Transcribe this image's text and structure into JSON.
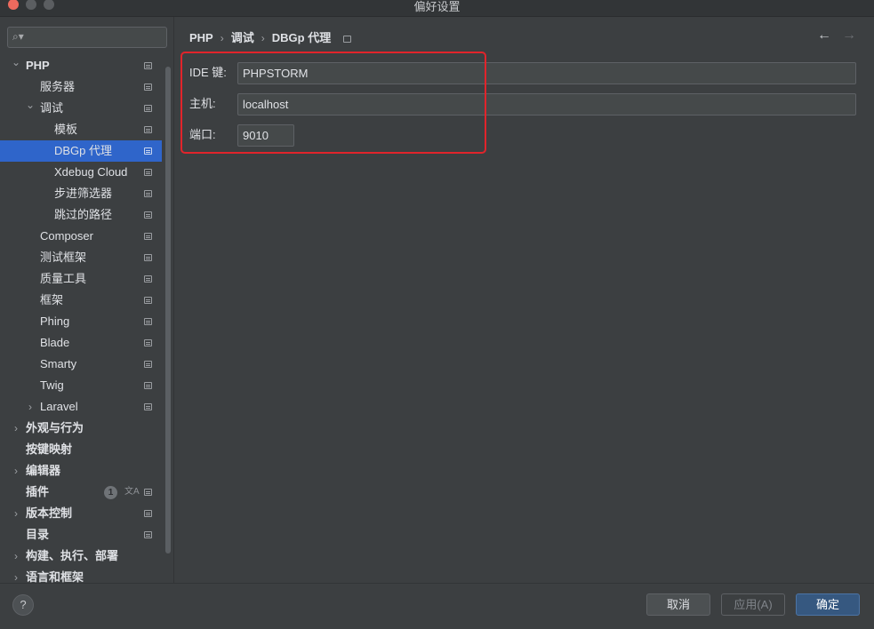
{
  "window": {
    "title": "偏好设置"
  },
  "sidebar": {
    "search": {
      "placeholder": ""
    },
    "items": [
      {
        "label": "PHP",
        "level": 0,
        "expanded": true,
        "bold": true,
        "pin": true
      },
      {
        "label": "服务器",
        "level": 1,
        "pin": true
      },
      {
        "label": "调试",
        "level": 1,
        "expanded": true,
        "pin": true
      },
      {
        "label": "模板",
        "level": 2,
        "pin": true
      },
      {
        "label": "DBGp 代理",
        "level": 2,
        "selected": true,
        "pin": true
      },
      {
        "label": "Xdebug Cloud",
        "level": 2,
        "pin": true
      },
      {
        "label": "步进筛选器",
        "level": 2,
        "pin": true
      },
      {
        "label": "跳过的路径",
        "level": 2,
        "pin": true
      },
      {
        "label": "Composer",
        "level": 1,
        "pin": true
      },
      {
        "label": "测试框架",
        "level": 1,
        "pin": true
      },
      {
        "label": "质量工具",
        "level": 1,
        "pin": true
      },
      {
        "label": "框架",
        "level": 1,
        "pin": true
      },
      {
        "label": "Phing",
        "level": 1,
        "pin": true
      },
      {
        "label": "Blade",
        "level": 1,
        "pin": true
      },
      {
        "label": "Smarty",
        "level": 1,
        "pin": true
      },
      {
        "label": "Twig",
        "level": 1,
        "pin": true
      },
      {
        "label": "Laravel",
        "level": 1,
        "collapsed": true,
        "pin": true
      },
      {
        "label": "外观与行为",
        "level": 0,
        "collapsed": true,
        "bold": true
      },
      {
        "label": "按键映射",
        "level": 0,
        "bold": true
      },
      {
        "label": "编辑器",
        "level": 0,
        "collapsed": true,
        "bold": true
      },
      {
        "label": "插件",
        "level": 0,
        "bold": true,
        "badge": "1",
        "translate": true,
        "pin": true
      },
      {
        "label": "版本控制",
        "level": 0,
        "collapsed": true,
        "bold": true,
        "pin": true
      },
      {
        "label": "目录",
        "level": 0,
        "bold": true,
        "pin": true
      },
      {
        "label": "构建、执行、部署",
        "level": 0,
        "collapsed": true,
        "bold": true
      },
      {
        "label": "语言和框架",
        "level": 0,
        "collapsed": true,
        "bold": true
      }
    ]
  },
  "breadcrumb": [
    "PHP",
    "调试",
    "DBGp 代理"
  ],
  "form": {
    "ide_key": {
      "label": "IDE 键:",
      "value": "PHPSTORM"
    },
    "host": {
      "label": "主机:",
      "value": "localhost"
    },
    "port": {
      "label": "端口:",
      "value": "9010"
    }
  },
  "footer": {
    "help": "?",
    "cancel": "取消",
    "apply": "应用(A)",
    "ok": "确定"
  },
  "colors": {
    "selection": "#2f65ca",
    "highlight_border": "#e1242b",
    "primary_button": "#365880"
  },
  "icons": {
    "back": "arrow-left-icon",
    "forward": "arrow-right-icon",
    "search": "search-icon",
    "pin": "settings-scope-icon"
  }
}
